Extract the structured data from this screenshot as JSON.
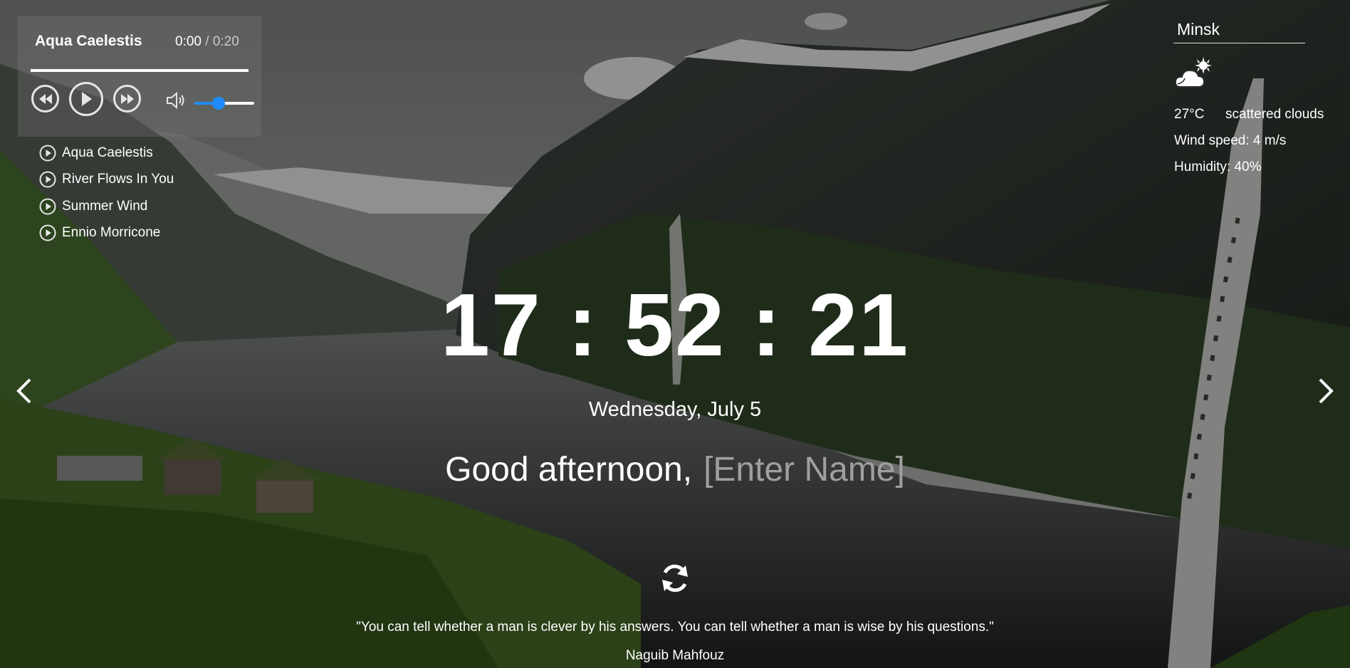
{
  "player": {
    "track_title": "Aqua Caelestis",
    "current_time": "0:00",
    "separator": " / ",
    "duration": "0:20",
    "progress": 1.0,
    "volume": 0.4,
    "playlist": [
      "Aqua Caelestis",
      "River Flows In You",
      "Summer Wind",
      "Ennio Morricone"
    ]
  },
  "weather": {
    "city": "Minsk",
    "icon": "partly-cloudy-icon",
    "temperature": "27°C",
    "description": "scattered clouds",
    "wind": "Wind speed: 4 m/s",
    "humidity": "Humidity: 40%"
  },
  "clock": {
    "time": "17 : 52 : 21"
  },
  "date": "Wednesday, July 5",
  "greeting": {
    "text": "Good afternoon,",
    "name_placeholder": "[Enter Name]"
  },
  "quote": {
    "text": "\"You can tell whether a man is clever by his answers. You can tell whether a man is wise by his questions.\"",
    "author": "Naguib Mahfouz"
  },
  "colors": {
    "accent": "#1f8bff",
    "placeholder": "#9f9f9f"
  }
}
